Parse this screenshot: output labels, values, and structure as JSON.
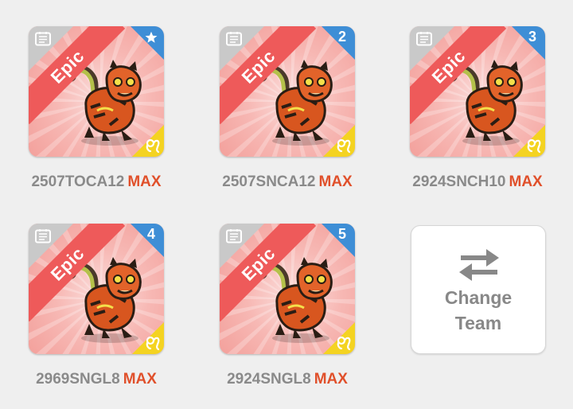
{
  "team": [
    {
      "rarity": "Epic",
      "badge": "★",
      "badge_icon": "star-icon",
      "element_icon": "leo-icon",
      "name": "2507TOCA12",
      "level": "MAX"
    },
    {
      "rarity": "Epic",
      "badge": "2",
      "element_icon": "leo-icon",
      "name": "2507SNCA12",
      "level": "MAX"
    },
    {
      "rarity": "Epic",
      "badge": "3",
      "element_icon": "leo-icon",
      "name": "2924SNCH10",
      "level": "MAX"
    },
    {
      "rarity": "Epic",
      "badge": "4",
      "element_icon": "leo-icon",
      "name": "2969SNGL8",
      "level": "MAX"
    },
    {
      "rarity": "Epic",
      "badge": "5",
      "element_icon": "leo-icon",
      "name": "2924SNGL8",
      "level": "MAX"
    }
  ],
  "change_team": {
    "line1": "Change",
    "line2": "Team",
    "icon": "swap-arrows-icon"
  },
  "colors": {
    "rarity_band": "#ee5a5a",
    "badge_blue": "#3e8ed6",
    "element_yellow": "#f4d321",
    "max_orange": "#e0502b",
    "label_gray": "#8a8a8a"
  }
}
